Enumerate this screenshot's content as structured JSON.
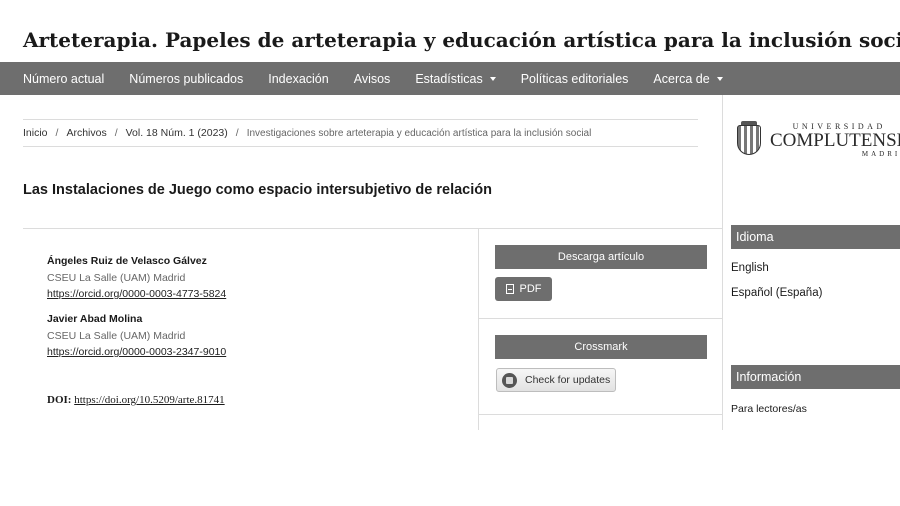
{
  "site": {
    "title": "Arteterapia. Papeles de arteterapia y educación artística para la inclusión social"
  },
  "nav": [
    {
      "label": "Número actual"
    },
    {
      "label": "Números publicados"
    },
    {
      "label": "Indexación"
    },
    {
      "label": "Avisos"
    },
    {
      "label": "Estadísticas",
      "dropdown": true
    },
    {
      "label": "Políticas editoriales"
    },
    {
      "label": "Acerca de",
      "dropdown": true
    }
  ],
  "breadcrumb": {
    "items": [
      "Inicio",
      "Archivos",
      "Vol. 18 Núm. 1 (2023)"
    ],
    "current": "Investigaciones sobre arteterapia y educación artística para la inclusión social",
    "separator": "/"
  },
  "article": {
    "title": "Las Instalaciones de Juego como espacio intersubjetivo de relación",
    "authors": [
      {
        "name": "Ángeles Ruiz de Velasco Gálvez",
        "affiliation": "CSEU La Salle (UAM) Madrid",
        "orcid": "https://orcid.org/0000-0003-4773-5824"
      },
      {
        "name": "Javier Abad Molina",
        "affiliation": "CSEU La Salle (UAM) Madrid",
        "orcid": "https://orcid.org/0000-0003-2347-9010"
      }
    ],
    "doi_label": "DOI:",
    "doi": "https://doi.org/10.5209/arte.81741"
  },
  "download": {
    "header": "Descarga artículo",
    "pdf_label": "PDF"
  },
  "crossmark": {
    "header": "Crossmark",
    "button_label": "Check for updates"
  },
  "logo": {
    "top": "UNIVERSIDAD",
    "middle": "COMPLUTENSE",
    "bottom": "MADRID"
  },
  "sidebar": {
    "language": {
      "header": "Idioma",
      "options": [
        "English",
        "Español (España)"
      ]
    },
    "info": {
      "header": "Información",
      "links": [
        "Para lectores/as"
      ]
    }
  },
  "colors": {
    "nav_bg": "#6e6e6e",
    "divider": "#dcdcdc"
  }
}
